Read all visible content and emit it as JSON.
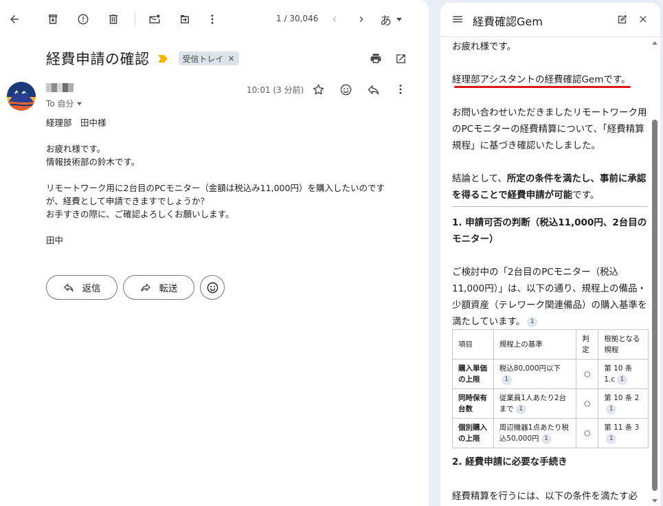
{
  "toolbar": {
    "pager": "1 / 30,046",
    "lang": "あ"
  },
  "message": {
    "subject": "経費申請の確認",
    "label": "受信トレイ",
    "label_remove": "×",
    "recipient": "To 自分",
    "time": "10:01 (3 分前)",
    "body": [
      "経理部　田中様",
      "",
      "お疲れ様です。",
      "情報技術部の鈴木です。",
      "",
      "リモートワーク用に2台目のPCモニター（金額は税込み11,000円）を購入したいのです",
      "が、経費として申請できますでしょうか？",
      "お手すきの際に、ご確認よろしくお願いします。",
      "",
      "田中"
    ],
    "reply_label": "返信",
    "forward_label": "転送"
  },
  "gem": {
    "title": "経費確認Gem",
    "greeting": "お疲れ様です。",
    "intro": "経理部アシスタントの経費確認Gemです。",
    "para1": "お問い合わせいただきましたリモートワーク用のPCモニターの経費精算について、「経費精算規程」に基づき確認いたしました。",
    "conclusion_pre": "結論として、",
    "conclusion_bold": "所定の条件を満たし、事前に承認を得ることで経費申請が可能",
    "conclusion_post": "です。",
    "section1": "1. 申請可否の判断（税込11,000円、2台目のモニター）",
    "para2": "ご検討中の「2台目のPCモニター（税込11,000円）」は、以下の通り、規程上の備品・少額資産（テレワーク関連備品）の購入基準を満たしています。",
    "cite": "1",
    "table": {
      "headers": [
        "項目",
        "規程上の基準",
        "判定",
        "根拠となる規程"
      ],
      "rows": [
        {
          "item": "購入単価の上限",
          "criterion": "税込80,000円以下",
          "judgement": "○",
          "rule": "第 10 条 1.c"
        },
        {
          "item": "同時保有台数",
          "criterion": "従業員1人あたり2台まで",
          "judgement": "○",
          "rule": "第 10 条 2"
        },
        {
          "item": "個別購入の上限",
          "criterion": "周辺機器1点あたり税込50,000円",
          "judgement": "○",
          "rule": "第 11 条 3"
        }
      ]
    },
    "section2": "2. 経費申請に必要な手続き",
    "para3": "経費精算を行うには、以下の条件を満たす必"
  },
  "colors": {
    "accent_underline": "#e3131b",
    "importance_marker": "#f4b400"
  }
}
